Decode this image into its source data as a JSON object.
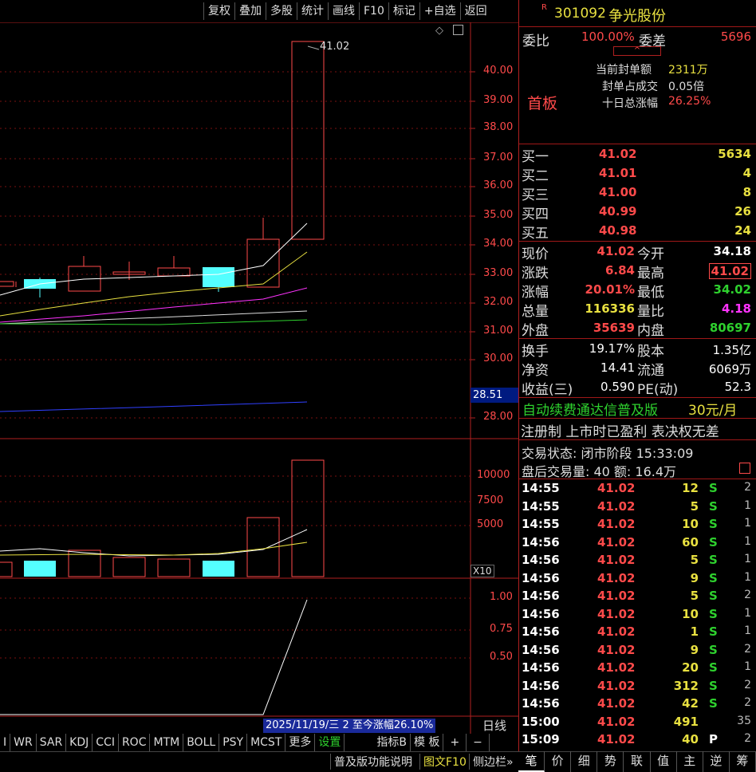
{
  "toolbar": [
    "复权",
    "叠加",
    "多股",
    "统计",
    "画线",
    "F10",
    "标记",
    "+自选",
    "返回"
  ],
  "stock": {
    "badge": "R",
    "code": "301092",
    "name": "争光股份"
  },
  "weibi": {
    "label": "委比",
    "value": "100.00%",
    "diff_label": "委差",
    "diff": "5696"
  },
  "board": {
    "tag": "首板",
    "items": [
      {
        "label": "当前封单额",
        "value": "2311万"
      },
      {
        "label": "封单占成交",
        "value": "0.05倍"
      },
      {
        "label": "十日总涨幅",
        "value": "26.25%"
      }
    ]
  },
  "bids": [
    {
      "label": "买一",
      "price": "41.02",
      "vol": "5634"
    },
    {
      "label": "买二",
      "price": "41.01",
      "vol": "4"
    },
    {
      "label": "买三",
      "price": "41.00",
      "vol": "8"
    },
    {
      "label": "买四",
      "price": "40.99",
      "vol": "26"
    },
    {
      "label": "买五",
      "price": "40.98",
      "vol": "24"
    }
  ],
  "quote": [
    {
      "l1": "现价",
      "v1": "41.02",
      "l2": "今开",
      "v2": "34.18"
    },
    {
      "l1": "涨跌",
      "v1": "6.84",
      "l2": "最高",
      "v2": "41.02"
    },
    {
      "l1": "涨幅",
      "v1": "20.01%",
      "l2": "最低",
      "v2": "34.02"
    },
    {
      "l1": "总量",
      "v1": "116336",
      "l2": "量比",
      "v2": "4.18"
    },
    {
      "l1": "外盘",
      "v1": "35639",
      "l2": "内盘",
      "v2": "80697"
    }
  ],
  "fund": [
    {
      "l1": "换手",
      "v1": "19.17%",
      "l2": "股本",
      "v2": "1.35亿"
    },
    {
      "l1": "净资",
      "v1": "14.41",
      "l2": "流通",
      "v2": "6069万"
    },
    {
      "l1": "收益(三)",
      "v1": "0.590",
      "l2": "PE(动)",
      "v2": "52.3"
    }
  ],
  "ad": {
    "text": "自动续费通达信普及版",
    "price": "30元/月"
  },
  "notice": "注册制 上市时已盈利 表决权无差",
  "status": {
    "line1": "交易状态: 闭市阶段 15:33:09",
    "line2": "盘后交易量: 40  额: 16.4万"
  },
  "ticks": [
    {
      "t": "14:55",
      "p": "41.02",
      "v": "12",
      "bs": "S",
      "n": "2"
    },
    {
      "t": "14:55",
      "p": "41.02",
      "v": "5",
      "bs": "S",
      "n": "1"
    },
    {
      "t": "14:55",
      "p": "41.02",
      "v": "10",
      "bs": "S",
      "n": "1"
    },
    {
      "t": "14:56",
      "p": "41.02",
      "v": "60",
      "bs": "S",
      "n": "1"
    },
    {
      "t": "14:56",
      "p": "41.02",
      "v": "5",
      "bs": "S",
      "n": "1"
    },
    {
      "t": "14:56",
      "p": "41.02",
      "v": "9",
      "bs": "S",
      "n": "1"
    },
    {
      "t": "14:56",
      "p": "41.02",
      "v": "5",
      "bs": "S",
      "n": "2"
    },
    {
      "t": "14:56",
      "p": "41.02",
      "v": "10",
      "bs": "S",
      "n": "1"
    },
    {
      "t": "14:56",
      "p": "41.02",
      "v": "1",
      "bs": "S",
      "n": "1"
    },
    {
      "t": "14:56",
      "p": "41.02",
      "v": "9",
      "bs": "S",
      "n": "2"
    },
    {
      "t": "14:56",
      "p": "41.02",
      "v": "20",
      "bs": "S",
      "n": "1"
    },
    {
      "t": "14:56",
      "p": "41.02",
      "v": "312",
      "bs": "S",
      "n": "2"
    },
    {
      "t": "14:56",
      "p": "41.02",
      "v": "42",
      "bs": "S",
      "n": "2"
    },
    {
      "t": "15:00",
      "p": "41.02",
      "v": "491",
      "bs": "",
      "n": "35"
    },
    {
      "t": "15:09",
      "p": "41.02",
      "v": "40",
      "bs": "P",
      "n": "2"
    }
  ],
  "chart": {
    "price_axis": [
      "40.00",
      "39.00",
      "38.00",
      "37.00",
      "36.00",
      "35.00",
      "34.00",
      "33.00",
      "32.00",
      "31.00",
      "30.00",
      "28.00"
    ],
    "last_ma_label": "28.51",
    "high_label": "41.02",
    "vol_axis": [
      "10000",
      "7500",
      "5000"
    ],
    "vol_unit": "X10",
    "ind_axis": [
      "1.00",
      "0.75",
      "0.50"
    ],
    "date_info": "2025/11/19/三 2 至今涨幅26.10%",
    "period": "日线"
  },
  "ind_tabs": [
    "I",
    "WR",
    "SAR",
    "KDJ",
    "CCI",
    "ROC",
    "MTM",
    "BOLL",
    "PSY",
    "MCST",
    "更多",
    "设置",
    "指标B",
    "模 板",
    "+",
    "−"
  ],
  "bottom_left": [
    "普及版功能说明",
    "图文F10",
    "侧边栏»"
  ],
  "bottom_right": [
    "笔",
    "价",
    "细",
    "势",
    "联",
    "值",
    "主",
    "逆",
    "筹"
  ],
  "colors": {
    "up": "#ff4a4a",
    "down": "#54ffff",
    "frame": "#b02020",
    "ma1": "#ffffff",
    "ma2": "#e8e040",
    "ma3": "#ff33ff",
    "ma4": "#2ed12e",
    "ma5": "#3040ff"
  }
}
